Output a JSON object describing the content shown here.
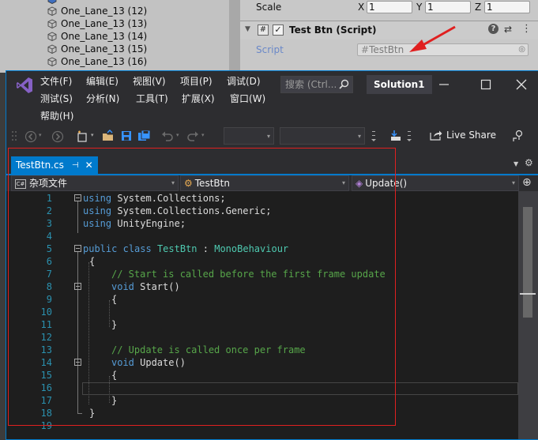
{
  "unity": {
    "hierarchy": [
      {
        "label": "One_Lane_13 (12)"
      },
      {
        "label": "One_Lane_13 (13)"
      },
      {
        "label": "One_Lane_13 (14)"
      },
      {
        "label": "One_Lane_13 (15)"
      },
      {
        "label": "One_Lane_13 (16)"
      }
    ],
    "inspector": {
      "scale_label": "Scale",
      "x_label": "X",
      "x_value": "1",
      "y_label": "Y",
      "y_value": "1",
      "z_label": "Z",
      "z_value": "1",
      "component_title": "Test Btn (Script)",
      "script_label": "Script",
      "script_value": "TestBtn"
    }
  },
  "vs": {
    "menu": {
      "file": "文件(F)",
      "edit": "编辑(E)",
      "view": "视图(V)",
      "project": "项目(P)",
      "debug": "调试(D)",
      "test": "测试(S)",
      "analyze": "分析(N)",
      "tools": "工具(T)",
      "extensions": "扩展(X)",
      "window": "窗口(W)",
      "help": "帮助(H)"
    },
    "search_placeholder": "搜索 (Ctrl...",
    "solution_name": "Solution1",
    "live_share": "Live Share",
    "tab": {
      "label": "TestBtn.cs"
    },
    "nav": {
      "project": "杂项文件",
      "class": "TestBtn",
      "member": "Update()"
    },
    "code": {
      "line_numbers": [
        "1",
        "2",
        "3",
        "4",
        "5",
        "6",
        "7",
        "8",
        "9",
        "10",
        "11",
        "12",
        "13",
        "14",
        "15",
        "16",
        "17",
        "18",
        "19"
      ],
      "using1_kw": "using",
      "using1_rest": " System.Collections;",
      "using2_kw": "using",
      "using2_rest": " System.Collections.Generic;",
      "using3_kw": "using",
      "using3_rest": " UnityEngine;",
      "cls_public": "public",
      "cls_class": "class",
      "cls_name": "TestBtn",
      "cls_base_sep": " : ",
      "cls_base": "MonoBehaviour",
      "brace_open": "{",
      "comment_start": "// Start is called before the first frame update",
      "void1": "void",
      "start_sig": " Start()",
      "comment_update": "// Update is called once per frame",
      "void2": "void",
      "update_sig": " Update()",
      "brace_close": "}"
    }
  },
  "colors": {
    "vs_accent": "#007acc",
    "annotation_red": "#e02020",
    "keyword": "#569cd6",
    "type": "#4ec9b0",
    "comment": "#57a64a",
    "line_number": "#2b91af"
  }
}
